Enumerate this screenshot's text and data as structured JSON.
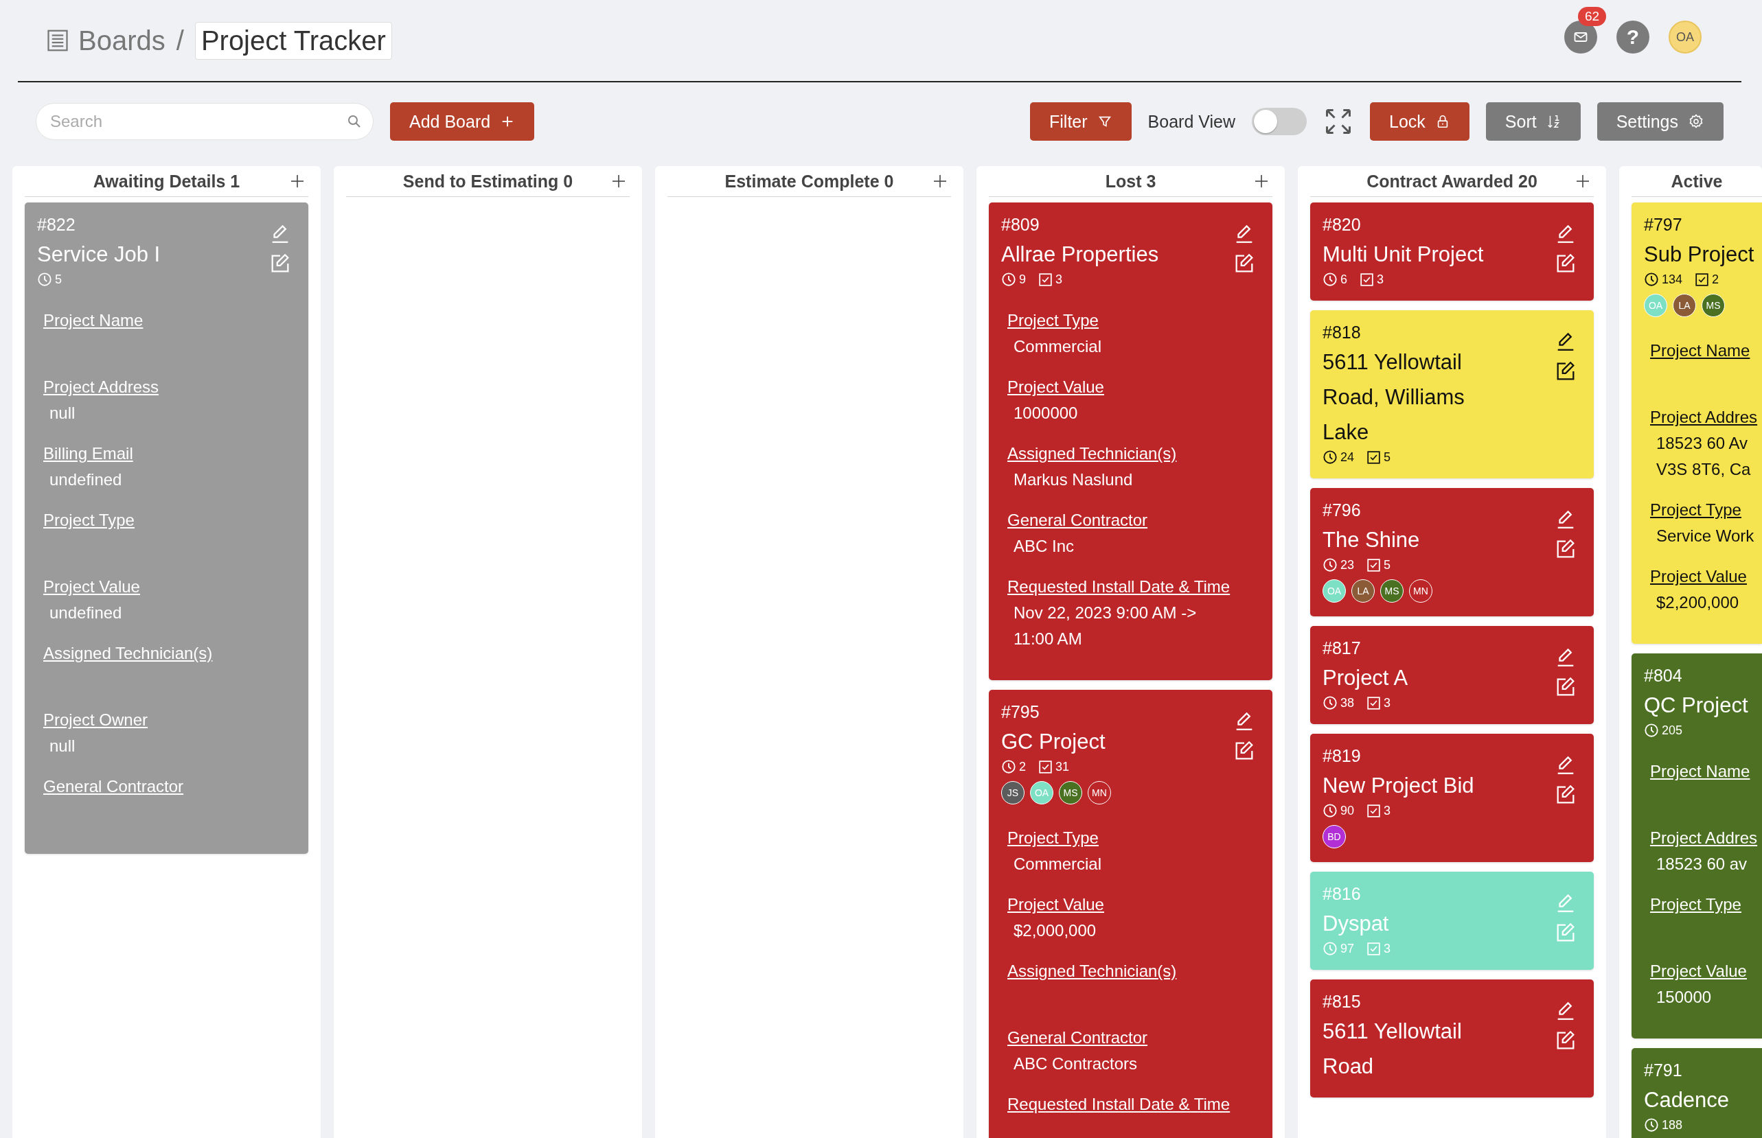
{
  "breadcrumb": {
    "root": "Boards",
    "separator": "/",
    "current": "Project Tracker"
  },
  "header": {
    "notifications": "62",
    "help": "?",
    "user": "OA"
  },
  "toolbar": {
    "search": {
      "placeholder": "Search"
    },
    "add_board": "Add Board",
    "filter": "Filter",
    "board_view": {
      "label": "Board View",
      "on": false
    },
    "lock": "Lock",
    "sort": "Sort",
    "settings": "Settings"
  },
  "columns": [
    {
      "title": "Awaiting Details 1",
      "cards": [
        {
          "number": "#822",
          "title": "Service Job I",
          "color": "#9b9b9b",
          "actions": true,
          "time": "5",
          "fields": [
            {
              "label": "Project Name"
            },
            {
              "label": "Project Address",
              "value": "null"
            },
            {
              "label": "Billing Email",
              "value": "undefined"
            },
            {
              "label": "Project Type"
            },
            {
              "label": "Project Value",
              "value": "undefined"
            },
            {
              "label": "Assigned Technician(s)"
            },
            {
              "label": "Project Owner",
              "value": "null"
            },
            {
              "label": "General Contractor"
            }
          ]
        }
      ]
    },
    {
      "title": "Send to Estimating 0"
    },
    {
      "title": "Estimate Complete 0"
    },
    {
      "title": "Lost 3",
      "cards": [
        {
          "number": "#809",
          "title": "Allrae Properties",
          "color": "#bd2629",
          "actions": true,
          "time": "9",
          "tasks": "3",
          "fields": [
            {
              "label": "Project Type",
              "value": "Commercial"
            },
            {
              "label": "Project Value",
              "value": "1000000"
            },
            {
              "label": "Assigned Technician(s)",
              "value": "Markus Naslund"
            },
            {
              "label": "General Contractor",
              "value": "ABC Inc"
            },
            {
              "label": "Requested Install Date & Time",
              "value": "Nov 22, 2023 9:00 AM -> 11:00 AM"
            }
          ]
        },
        {
          "number": "#795",
          "title": "GC Project",
          "color": "#bd2629",
          "actions": true,
          "time": "2",
          "tasks": "31",
          "avatars": [
            {
              "initials": "JS",
              "color": "#5c5c5c"
            },
            {
              "initials": "OA",
              "color": "#7de0c4"
            },
            {
              "initials": "MS",
              "color": "#4a7022"
            },
            {
              "initials": "MN",
              "color": "#bd2629"
            }
          ],
          "fields": [
            {
              "label": "Project Type",
              "value": "Commercial"
            },
            {
              "label": "Project Value",
              "value": "$2,000,000"
            },
            {
              "label": "Assigned Technician(s)"
            },
            {
              "label": "General Contractor",
              "value": "ABC Contractors"
            },
            {
              "label": "Requested Install Date & Time"
            }
          ]
        }
      ]
    },
    {
      "title": "Contract Awarded 20",
      "cards": [
        {
          "number": "#820",
          "title": "Multi Unit Project",
          "color": "#bd2629",
          "actions": true,
          "time": "6",
          "tasks": "3"
        },
        {
          "number": "#818",
          "title": "5611 Yellowtail Road, Williams Lake",
          "color": "#f5e44f",
          "actions": true,
          "time": "24",
          "tasks": "5"
        },
        {
          "number": "#796",
          "title": "The Shine",
          "color": "#bd2629",
          "actions": true,
          "time": "23",
          "tasks": "5",
          "avatars": [
            {
              "initials": "OA",
              "color": "#7de0c4"
            },
            {
              "initials": "LA",
              "color": "#8b5a36"
            },
            {
              "initials": "MS",
              "color": "#4a7022"
            },
            {
              "initials": "MN",
              "color": "#bd2629"
            }
          ]
        },
        {
          "number": "#817",
          "title": "Project A",
          "color": "#bd2629",
          "actions": true,
          "time": "38",
          "tasks": "3"
        },
        {
          "number": "#819",
          "title": "New Project Bid",
          "color": "#bd2629",
          "actions": true,
          "time": "90",
          "tasks": "3",
          "avatars": [
            {
              "initials": "BD",
              "color": "#b22fd6"
            }
          ]
        },
        {
          "number": "#816",
          "title": "Dyspat",
          "color": "#7de0c4",
          "actions": true,
          "time": "97",
          "tasks": "3"
        },
        {
          "number": "#815",
          "title": "5611 Yellowtail Road",
          "color": "#bd2629",
          "actions": true
        }
      ]
    },
    {
      "title": "Active",
      "cards": [
        {
          "number": "#797",
          "title": "Sub Project",
          "color": "#f5e44f",
          "actions": false,
          "time": "134",
          "tasks": "2",
          "avatars": [
            {
              "initials": "OA",
              "color": "#7de0c4"
            },
            {
              "initials": "LA",
              "color": "#8b5a36"
            },
            {
              "initials": "MS",
              "color": "#4a7022"
            }
          ],
          "fields": [
            {
              "label": "Project Name"
            },
            {
              "label": "Project Addres",
              "value": "18523 60 Av V3S 8T6, Ca"
            },
            {
              "label": "Project Type",
              "value": "Service Work"
            },
            {
              "label": "Project Value",
              "value": "$2,200,000"
            }
          ]
        },
        {
          "number": "#804",
          "title": "QC Project",
          "color": "#4e7022",
          "actions": false,
          "time": "205",
          "fields": [
            {
              "label": "Project Name"
            },
            {
              "label": "Project Addres",
              "value": "18523 60 av"
            },
            {
              "label": "Project Type"
            },
            {
              "label": "Project Value",
              "value": "150000"
            }
          ]
        },
        {
          "number": "#791",
          "title": "Cadence",
          "color": "#4e7022",
          "actions": false,
          "time": "188"
        }
      ]
    }
  ]
}
